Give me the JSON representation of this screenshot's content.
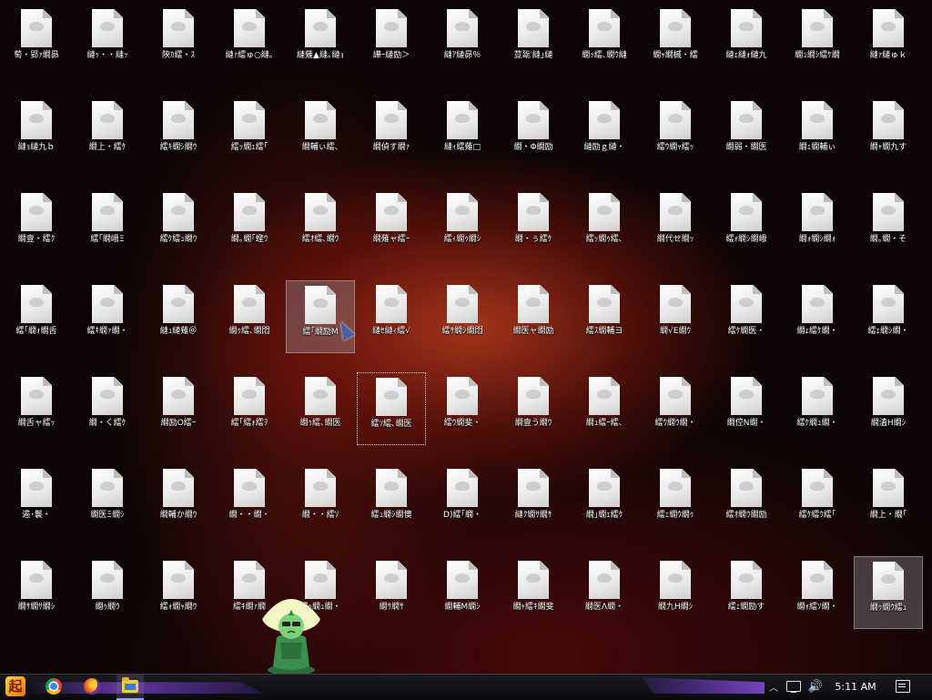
{
  "desktop": {
    "icons": [
      [
        "萄・郢ｧ繝昴",
        "縺ｯ・・縺ｯ",
        "陝ｶ繧・ｽ",
        "縺ｧ繧ゅ○縺｡",
        "縺薙▲縺｡縺ｮ",
        "譁ｰ縺励＞",
        "縺ｱ縺昴％",
        "荳翫′縺｣縺",
        "繝ｯ繧､繝ｳ縺",
        "繝ｬ繝槭・繧",
        "縺ｪ縺ｫ縺九",
        "繝ｭ繝ｼ繧ｹ繝",
        "縺ｧ縺ゅｋ"
      ],
      [
        "縺ｮ縺九ｂ",
        "繝上・繧ｹ",
        "繧ｷ繝ｼ繝ｳ",
        "繧ｯ繝ｪ繧｢",
        "繝輔ぃ繧､",
        "繝偵す繝ｧ",
        "縺ｨ繧薙□",
        "繝・Φ繝励",
        "縺励ｇ縺・",
        "繧ｳ繝ｬ繧ｯ",
        "繝弱・繝医",
        "繝ｪ繝輔ぃ",
        "繝ｬ繝九す"
      ],
      [
        "繝壹・繧ｸ",
        "繧｢繝峨Ξ",
        "繧ｹ繧ｭ繝ｳ",
        "繝｡繝｢蟶ｳ",
        "繧ｵ繧､繝ｳ",
        "繝薙ャ繧ｰ",
        "繧ｨ繝ｩ繝ｼ",
        "繝・ぅ繧ｹ",
        "繧ｯ繝ｩ繧､",
        "繝代せ繝ｯ",
        "繧ｫ繝ｼ繝峨",
        "繝ｫ繝ｼ繝ｫ",
        "繝｡繝・そ"
      ],
      [
        "繧｢繝ｫ繝舌",
        "繧ｷ繝ｧ繝・",
        "縺ｭ縺薙＠",
        "繝ｩ繧､繝悶",
        "繧｢繝励Μ",
        "縺ｾ縺ｨ繧√",
        "繧ｻ繝ｼ繝悶",
        "繝医ャ繝励",
        "繧ｽ繝輔ヨ",
        "繝√Ε繝ｳ",
        "繧ｹ繝医・",
        "繝ｪ繧ｹ繝・",
        "繧ｪ繝ｼ繝・"
      ],
      [
        "繝舌ャ繧ｯ",
        "繝・く繧ｹ",
        "繝励Ο繧ｰ",
        "繧｢繧ｫ繧ｦ",
        "繝ｩ繧､繝医",
        "繧ｿ繧､繝医",
        "繧ｳ繝斐・",
        "繝壹う繝ｳ",
        "繝ｭ繧ｰ繧､",
        "繧ｳ繝ｳ繝・",
        "繝倥Ν繝・",
        "繧ｹ繝ｭ繝・",
        "繝溘Η繝ｼ"
      ],
      [
        "遏･鬟・",
        "繝医Ξ繝ｼ",
        "繝輔か繝ｳ",
        "繝・・繝・",
        "繝・・繧ｿ",
        "繧ｭ繝ｼ繝懊",
        "D)繧｢繝・",
        "縺ｸ繝ｻ繝ｻ",
        "繝｣繝ｪ繧ｹ",
        "繧ｪ繝ｳ繝ｩ",
        "繧ｵ繝ｳ繝励",
        "繧ｹ繧ｳ繧｢",
        "繝上・繝｢"
      ],
      [
        "繝ｻ繝ｻ繝ｼ",
        "繝ｩ繝ｳ",
        "繧ｫ繝ｬ繝ｳ",
        "繧ｷ繝ｧ繝",
        "繧ｯ繝ｭ繝・",
        "繝ｻ繝ｻ",
        "繝輔Μ繝ｼ",
        "繝ｬ繧ｷ繝斐",
        "繝医Λ繝・",
        "繝九Η繝ｼ",
        "繧ｪ繝励す",
        "繝ｫ繧ｿ繝・",
        "繝ｩ繝ｳ繧ｭ"
      ]
    ],
    "selected": [
      [
        3,
        4
      ],
      [
        6,
        12
      ]
    ],
    "focused": [
      [
        4,
        5
      ]
    ]
  },
  "taskbar": {
    "start_label": "起",
    "pinned": [
      "chrome-icon",
      "firefox-icon",
      "file-explorer-icon"
    ],
    "tray_chevron": "︿",
    "volume_glyph": "🔊",
    "clock": "5:11 AM"
  },
  "colors": {
    "accent_purple": "#8a4fe0",
    "wallpaper_red": "#b0301c"
  }
}
